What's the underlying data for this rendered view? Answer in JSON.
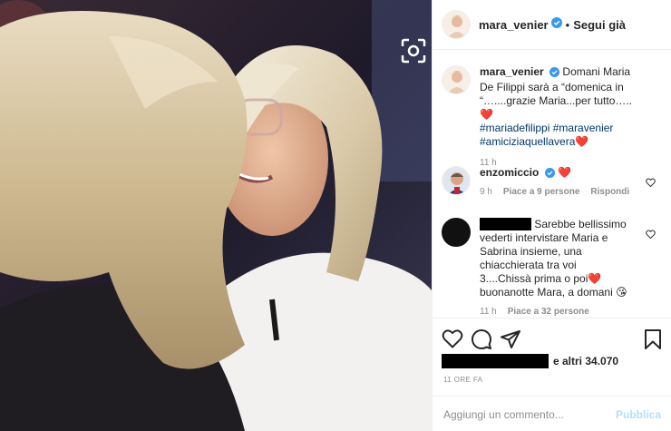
{
  "post": {
    "username": "mara_venier",
    "follow_status": "Segui già",
    "separator": "•",
    "caption": "Domani Maria De Filippi sarà a “domenica in “…....grazie Maria...per tutto….. ",
    "caption_heart": "❤️",
    "hashtags": [
      "#mariadefilippi",
      "#maravenier",
      "#amiciziaquellavera"
    ],
    "hashtag_heart": "❤️",
    "caption_time": "11 h"
  },
  "comments": [
    {
      "username": "enzomiccio",
      "text": "❤️",
      "time": "9 h",
      "likes": "Piace a 9 persone",
      "reply": "Rispondi"
    },
    {
      "username": "[redacted]",
      "text": "Sarebbe bellissimo vederti intervistare Maria e Sabrina insieme, una chiacchierata tra voi 3....Chissà prima o poi",
      "heart": "❤️",
      "text2": " buonanotte Mara, a domani ",
      "emoji": "😘",
      "time": "11 h",
      "likes": "Piace a 32 persone"
    }
  ],
  "likes": {
    "others": "e altri 34.070"
  },
  "timestamp": "11 ORE FA",
  "comment_box": {
    "placeholder": "Aggiungi un commento...",
    "publish": "Pubblica"
  },
  "icons": [
    "heart-icon",
    "comment-icon",
    "share-icon",
    "bookmark-icon",
    "scan-icon",
    "verified-icon"
  ],
  "colors": {
    "link": "#00376b",
    "verified": "#3897f0",
    "muted": "#8e8e8e",
    "publish_disabled": "#b2dffc"
  }
}
